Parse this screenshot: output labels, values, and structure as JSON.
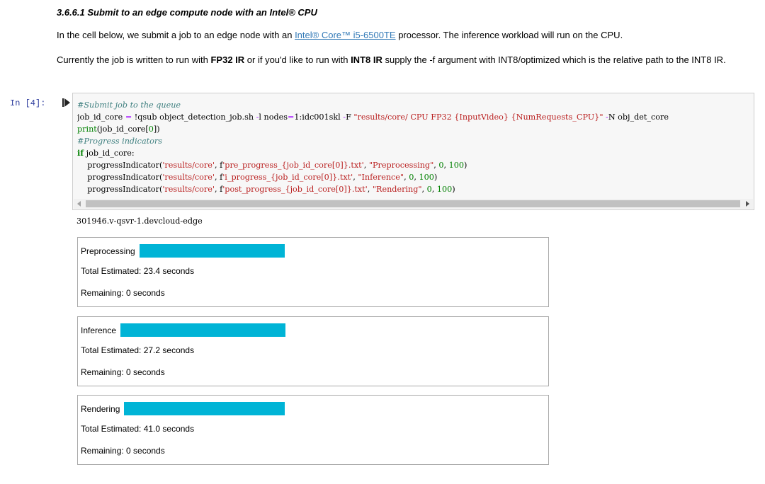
{
  "section": {
    "heading": "3.6.6.1 Submit to an edge compute node with an Intel® CPU",
    "p1_before": "In the cell below, we submit a job to an edge node with an ",
    "p1_link": "Intel® Core™ i5-6500TE",
    "p1_after": " processor. The inference workload will run on the CPU.",
    "p2_a": "Currently the job is written to run with ",
    "p2_b": "FP32 IR",
    "p2_c": " or if you'd like to run with ",
    "p2_d": "INT8 IR",
    "p2_e": " supply the -f argument with INT8/optimized which is the relative path to the INT8 IR."
  },
  "cell": {
    "prompt": "In  [4]:",
    "code": {
      "l1_comment": "#Submit job to the queue",
      "l2_a": "job_id_core ",
      "l2_eq": "=",
      "l2_b": " !qsub object_detection_job.sh ",
      "l2_c": "-",
      "l2_d": "l nodes",
      "l2_e": "=",
      "l2_f": "1:idc001skl ",
      "l2_g": "-",
      "l2_h": "F ",
      "l2_str": "\"results/core/ CPU FP32 {InputVideo} {NumRequests_CPU}\"",
      "l2_i": " ",
      "l2_j": "-",
      "l2_k": "N obj_det_core",
      "l3_fn": "print",
      "l3_rest": "(job_id_core[",
      "l3_num": "0",
      "l3_end": "])",
      "l4_comment": "#Progress indicators",
      "l5_kw": "if",
      "l5_rest": " job_id_core:",
      "l6_a": "    progressIndicator(",
      "l6_s1": "'results/core'",
      "l6_b": ", f",
      "l6_s2": "'pre_progress_{job_id_core[0]}.txt'",
      "l6_c": ", ",
      "l6_s3": "\"Preprocessing\"",
      "l6_d": ", ",
      "l6_n1": "0",
      "l6_e": ", ",
      "l6_n2": "100",
      "l6_f": ")",
      "l7_a": "    progressIndicator(",
      "l7_s1": "'results/core'",
      "l7_b": ", f",
      "l7_s2": "'i_progress_{job_id_core[0]}.txt'",
      "l7_c": ", ",
      "l7_s3": "\"Inference\"",
      "l7_d": ", ",
      "l7_n1": "0",
      "l7_e": ", ",
      "l7_n2": "100",
      "l7_f": ")",
      "l8_a": "    progressIndicator(",
      "l8_s1": "'results/core'",
      "l8_b": ", f",
      "l8_s2": "'post_progress_{job_id_core[0]}.txt'",
      "l8_c": ", ",
      "l8_s3": "\"Rendering\"",
      "l8_d": ", ",
      "l8_n1": "0",
      "l8_e": ", ",
      "l8_n2": "100",
      "l8_f": ")"
    },
    "output": "301946.v-qsvr-1.devcloud-edge"
  },
  "progress": [
    {
      "label": "Preprocessing",
      "progress_fraction": 1.0,
      "estimated": "Total Estimated:  23.4 seconds",
      "remaining": "Remaining:  0 seconds"
    },
    {
      "label": "Inference",
      "progress_fraction": 1.0,
      "estimated": "Total Estimated:  27.2 seconds",
      "remaining": "Remaining:  0 seconds"
    },
    {
      "label": "Rendering",
      "progress_fraction": 1.0,
      "estimated": "Total Estimated:  41.0 seconds",
      "remaining": "Remaining:  0 seconds"
    }
  ],
  "colors": {
    "progress_bar": "#00b4d6",
    "link": "#337ab7",
    "prompt": "#303f9f"
  },
  "icons": {
    "run": "run-cell-icon"
  }
}
